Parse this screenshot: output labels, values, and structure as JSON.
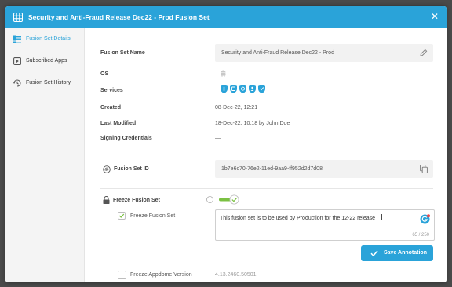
{
  "header": {
    "title": "Security and Anti-Fraud Release Dec22 - Prod Fusion Set",
    "close_icon": "✕"
  },
  "sidebar": {
    "items": [
      {
        "label": "Fusion Set Details",
        "icon": "details-icon",
        "active": true
      },
      {
        "label": "Subscribed Apps",
        "icon": "apps-icon",
        "active": false
      },
      {
        "label": "Fusion Set History",
        "icon": "history-icon",
        "active": false
      }
    ]
  },
  "details": {
    "name_label": "Fusion Set Name",
    "name_value": "Security and Anti-Fraud Release Dec22 - Prod",
    "os_label": "OS",
    "services_label": "Services",
    "created_label": "Created",
    "created_value": "08-Dec-22, 12:21",
    "modified_label": "Last Modified",
    "modified_value": "18-Dec-22, 10:18 by John Doe",
    "signing_label": "Signing Credentials",
    "signing_value": "—",
    "id_label": "Fusion Set ID",
    "id_value": "1b7e6c70-76e2-11ed-9aa9-ff952d2d7d08"
  },
  "freeze": {
    "section_label": "Freeze Fusion Set",
    "checkbox_label": "Freeze Fusion Set",
    "checkbox_checked": true,
    "toggle_on": true,
    "annotation_text": "This fusion set is to be used by Production for the 12-22 release",
    "char_count": "65 / 250",
    "save_label": "Save Annotation",
    "appdome_label": "Freeze Appdome Version",
    "appdome_version": "4.13.2460.50501",
    "appdome_checked": false
  },
  "colors": {
    "accent": "#2aa3d9",
    "toggle_green": "#7bc142"
  }
}
